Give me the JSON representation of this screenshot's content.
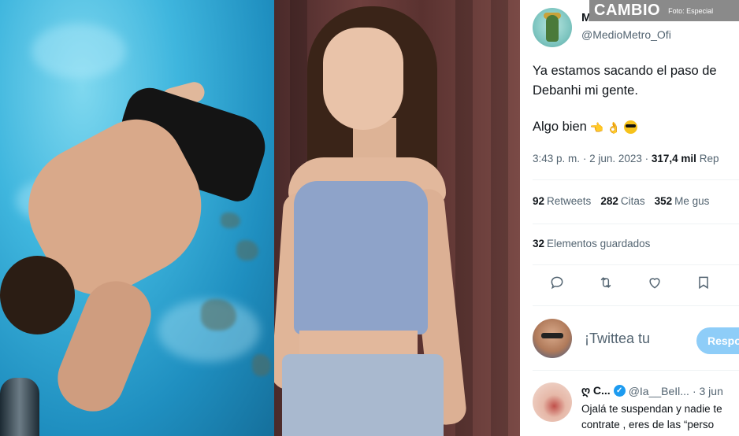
{
  "brand": {
    "logo_text": "CAMBIO",
    "photo_credit": "Foto: Especial"
  },
  "tweet": {
    "display_name": "Medio Metro Oficial",
    "handle": "@MedioMetro_Ofi",
    "text_line1": "Ya estamos sacando el paso de Debanhi mi gente.",
    "text_line2": "Algo bien",
    "emojis": [
      "hand-pointing-icon",
      "ok-hand-icon",
      "sunglasses-face-icon"
    ],
    "time": "3:43 p. m.",
    "date": "2 jun. 2023",
    "views_count": "317,4 mil",
    "views_label": "Rep",
    "retweets_count": "92",
    "retweets_label": "Retweets",
    "quotes_count": "282",
    "quotes_label": "Citas",
    "likes_count": "352",
    "likes_label": "Me gus",
    "saved_count": "32",
    "saved_label": "Elementos guardados"
  },
  "actions": [
    "reply-icon",
    "retweet-icon",
    "like-icon",
    "bookmark-icon"
  ],
  "reply_box": {
    "placeholder": "¡Twittea tu",
    "button_label": "Respon"
  },
  "comment": {
    "name": "ღ C...",
    "handle": "@Ia__BeIl...",
    "time": "· 3 jun",
    "body": "Ojalá te suspendan y nadie te contrate , eres de las “perso"
  },
  "colors": {
    "accent": "#1d9bf0",
    "reply_button": "#8ecdf8",
    "secondary_text": "#536471",
    "banner": "#8a8a8a"
  }
}
